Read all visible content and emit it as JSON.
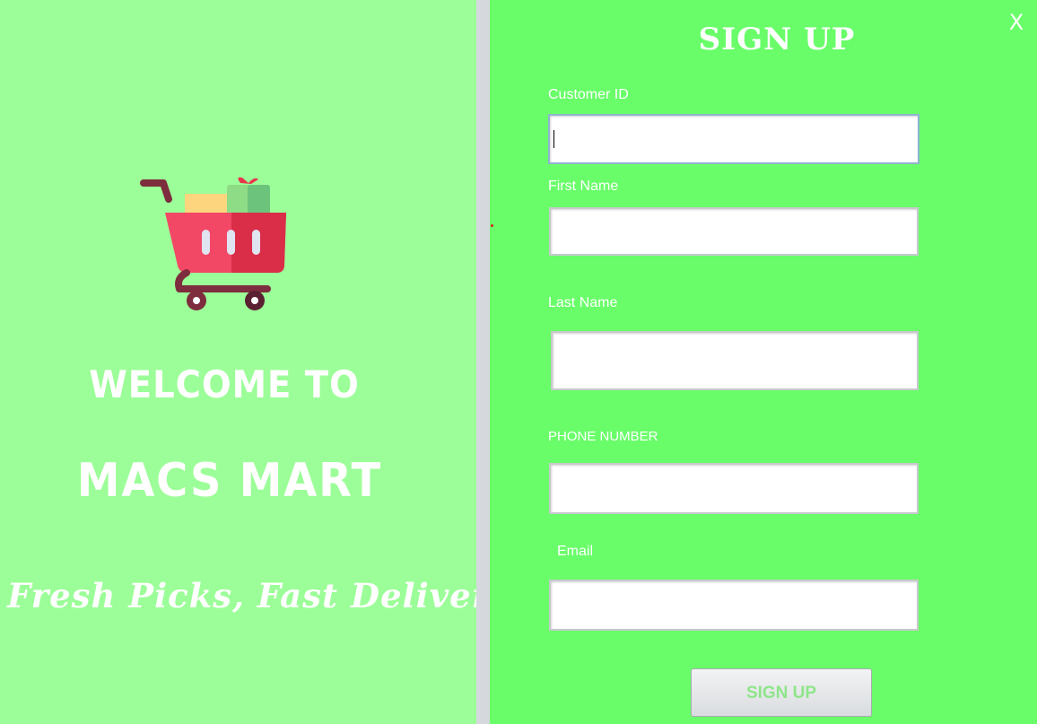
{
  "window": {
    "close_label": "X"
  },
  "welcome": {
    "line1": "WELCOME TO",
    "brand": "MACS MART",
    "tagline": "Fresh Picks, Fast Delivery",
    "logo_icon": "shopping-cart-icon"
  },
  "form": {
    "title": "SIGN UP",
    "fields": [
      {
        "label": "Customer ID",
        "value": ""
      },
      {
        "label": "First Name",
        "value": ""
      },
      {
        "label": "Last Name",
        "value": ""
      },
      {
        "label": "PHONE NUMBER",
        "value": ""
      },
      {
        "label": "Email",
        "value": ""
      }
    ],
    "submit_label": "SIGN UP"
  },
  "colors": {
    "left_background": "#9cfe98",
    "right_background": "#69fe69",
    "divider": "#d5d9de",
    "button_text": "#8fe58a"
  }
}
